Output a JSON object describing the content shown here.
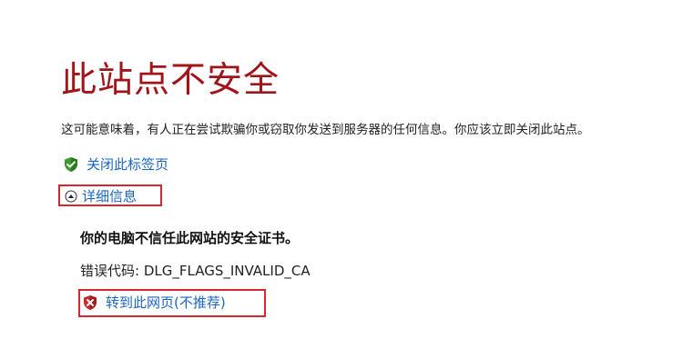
{
  "page": {
    "title": "此站点不安全",
    "message": "这可能意味着，有人正在尝试欺骗你或窃取你发送到服务器的任何信息。你应该立即关闭此站点。"
  },
  "actions": {
    "close_tab_label": "关闭此标签页",
    "details_label": "详细信息"
  },
  "details": {
    "subheading": "你的电脑不信任此网站的安全证书。",
    "error_code_label": "错误代码:",
    "error_code_value": "DLG_FLAGS_INVALID_CA",
    "proceed_label": "转到此网页(不推荐)"
  },
  "icons": {
    "close_tab": "shield-check-icon",
    "details": "chevron-up-circle-icon",
    "proceed": "shield-x-icon"
  },
  "colors": {
    "title": "#a0141a",
    "link": "#1a66c2",
    "highlight_box": "#d8252e",
    "shield_safe": "#3c9a2e",
    "shield_danger": "#c92a2a"
  }
}
